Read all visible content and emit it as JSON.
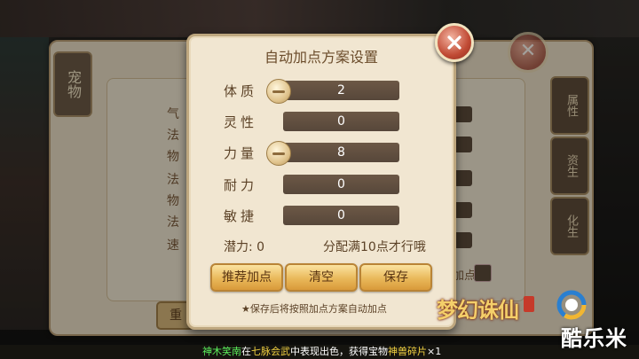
{
  "background": {
    "panel_tab": "宠物",
    "side_tabs": [
      "属性",
      "资生",
      "化生"
    ],
    "row_labels": [
      "气",
      "法",
      "物",
      "法",
      "物",
      "法",
      "速"
    ],
    "reset_label": "重",
    "checkbox_label": "加点"
  },
  "dialog": {
    "title": "自动加点方案设置",
    "attributes": [
      {
        "label": "体质",
        "value": "2",
        "has_minus": true
      },
      {
        "label": "灵性",
        "value": "0",
        "has_minus": false
      },
      {
        "label": "力量",
        "value": "8",
        "has_minus": true
      },
      {
        "label": "耐力",
        "value": "0",
        "has_minus": false
      },
      {
        "label": "敏捷",
        "value": "0",
        "has_minus": false
      }
    ],
    "potential": "潜力: 0",
    "hint": "分配满10点才行哦",
    "buttons": {
      "recommend": "推荐加点",
      "clear": "清空",
      "save": "保存"
    },
    "note": "★保存后将按照加点方案自动加点"
  },
  "ticker": {
    "name": "神木笑南",
    "text1": "在",
    "place": "七脉会武",
    "text2": "中表现出色，获得宝物",
    "item": "神兽碎片",
    "count": "×1"
  },
  "branding": {
    "game_logo": "梦幻诛仙",
    "watermark": "酷乐米"
  },
  "colors": {
    "accent": "#e9b85a",
    "close": "#c04a34",
    "field": "#5f4e3f"
  }
}
